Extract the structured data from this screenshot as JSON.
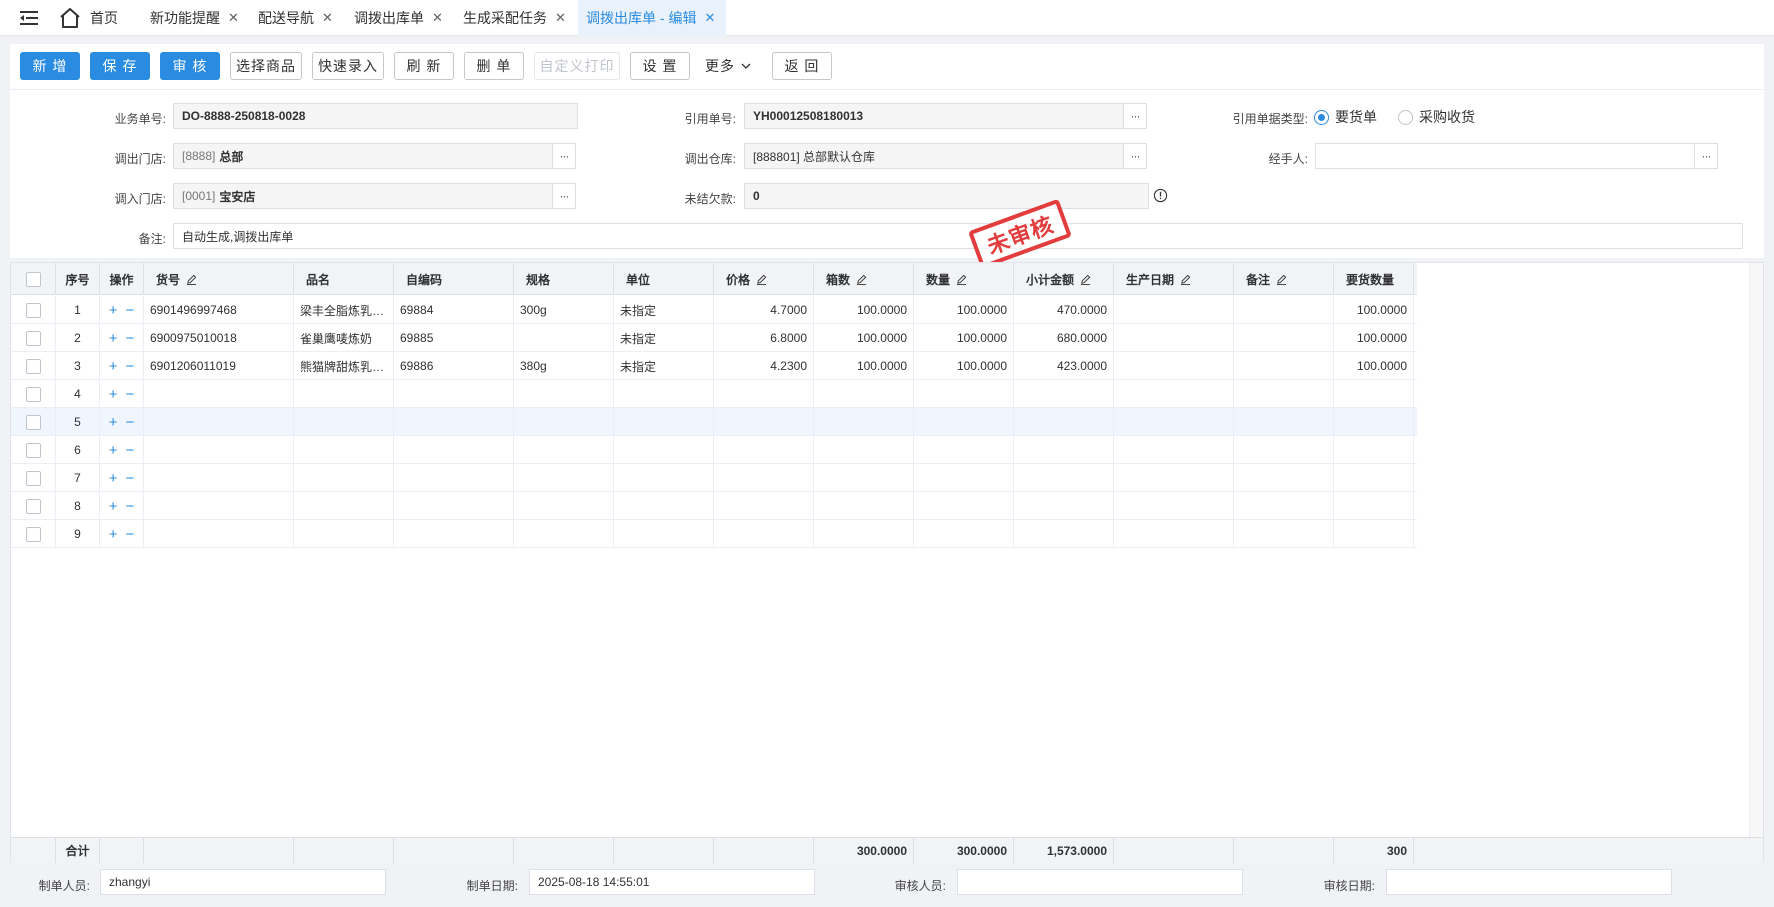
{
  "tabs": {
    "home": "首页",
    "items": [
      "新功能提醒",
      "配送导航",
      "调拨出库单",
      "生成采配任务",
      "调拨出库单 - 编辑"
    ]
  },
  "toolbar": {
    "add": "新 增",
    "save": "保 存",
    "audit": "审 核",
    "select_goods": "选择商品",
    "quick_entry": "快速录入",
    "refresh": "刷 新",
    "delete": "删 单",
    "custom_print": "自定义打印",
    "settings": "设 置",
    "more": "更多",
    "back": "返 回"
  },
  "form": {
    "doc_no_label": "业务单号:",
    "doc_no": "DO-8888-250818-0028",
    "ref_no_label": "引用单号:",
    "ref_no": "YH00012508180013",
    "ref_type_label": "引用单据类型:",
    "ref_type_option1": "要货单",
    "ref_type_option2": "采购收货",
    "out_store_label": "调出门店:",
    "out_store_code": "[8888]",
    "out_store_name": "总部",
    "out_wh_label": "调出仓库:",
    "out_wh": "[888801] 总部默认仓库",
    "handler_label": "经手人:",
    "handler": "",
    "in_store_label": "调入门店:",
    "in_store_code": "[0001]",
    "in_store_name": "宝安店",
    "debt_label": "未结欠款:",
    "debt": "0",
    "remark_label": "备注:",
    "remark": "自动生成,调拨出库单",
    "stamp": "未审核"
  },
  "grid": {
    "headers": {
      "seq": "序号",
      "op": "操作",
      "sku": "货号",
      "name": "品名",
      "code": "自编码",
      "spec": "规格",
      "unit": "单位",
      "price": "价格",
      "boxes": "箱数",
      "qty": "数量",
      "subtotal": "小计金额",
      "prod_date": "生产日期",
      "note": "备注",
      "req_qty": "要货数量"
    },
    "rows": [
      {
        "seq": "1",
        "sku": "6901496997468",
        "name": "梁丰全脂炼乳…",
        "code": "69884",
        "spec": "300g",
        "unit": "未指定",
        "price": "4.7000",
        "boxes": "100.0000",
        "qty": "100.0000",
        "subtotal": "470.0000",
        "prod_date": "",
        "note": "",
        "req_qty": "100.0000"
      },
      {
        "seq": "2",
        "sku": "6900975010018",
        "name": "雀巢鹰唛炼奶",
        "code": "69885",
        "spec": "",
        "unit": "未指定",
        "price": "6.8000",
        "boxes": "100.0000",
        "qty": "100.0000",
        "subtotal": "680.0000",
        "prod_date": "",
        "note": "",
        "req_qty": "100.0000"
      },
      {
        "seq": "3",
        "sku": "6901206011019",
        "name": "熊猫牌甜炼乳…",
        "code": "69886",
        "spec": "380g",
        "unit": "未指定",
        "price": "4.2300",
        "boxes": "100.0000",
        "qty": "100.0000",
        "subtotal": "423.0000",
        "prod_date": "",
        "note": "",
        "req_qty": "100.0000"
      },
      {
        "seq": "4",
        "sku": "",
        "name": "",
        "code": "",
        "spec": "",
        "unit": "",
        "price": "",
        "boxes": "",
        "qty": "",
        "subtotal": "",
        "prod_date": "",
        "note": "",
        "req_qty": ""
      },
      {
        "seq": "5",
        "sku": "",
        "name": "",
        "code": "",
        "spec": "",
        "unit": "",
        "price": "",
        "boxes": "",
        "qty": "",
        "subtotal": "",
        "prod_date": "",
        "note": "",
        "req_qty": ""
      },
      {
        "seq": "6",
        "sku": "",
        "name": "",
        "code": "",
        "spec": "",
        "unit": "",
        "price": "",
        "boxes": "",
        "qty": "",
        "subtotal": "",
        "prod_date": "",
        "note": "",
        "req_qty": ""
      },
      {
        "seq": "7",
        "sku": "",
        "name": "",
        "code": "",
        "spec": "",
        "unit": "",
        "price": "",
        "boxes": "",
        "qty": "",
        "subtotal": "",
        "prod_date": "",
        "note": "",
        "req_qty": ""
      },
      {
        "seq": "8",
        "sku": "",
        "name": "",
        "code": "",
        "spec": "",
        "unit": "",
        "price": "",
        "boxes": "",
        "qty": "",
        "subtotal": "",
        "prod_date": "",
        "note": "",
        "req_qty": ""
      },
      {
        "seq": "9",
        "sku": "",
        "name": "",
        "code": "",
        "spec": "",
        "unit": "",
        "price": "",
        "boxes": "",
        "qty": "",
        "subtotal": "",
        "prod_date": "",
        "note": "",
        "req_qty": ""
      }
    ],
    "ops": {
      "add": "+",
      "remove": "−"
    },
    "footer": {
      "label": "合计",
      "boxes": "300.0000",
      "qty": "300.0000",
      "subtotal": "1,573.0000",
      "req_qty": "300"
    }
  },
  "bottom": {
    "maker_label": "制单人员:",
    "maker": "zhangyi",
    "make_date_label": "制单日期:",
    "make_date": "2025-08-18 14:55:01",
    "auditor_label": "审核人员:",
    "auditor": "",
    "audit_date_label": "审核日期:",
    "audit_date": ""
  },
  "colors": {
    "accent": "#2a8ce0",
    "stamp": "#e23c3c"
  }
}
